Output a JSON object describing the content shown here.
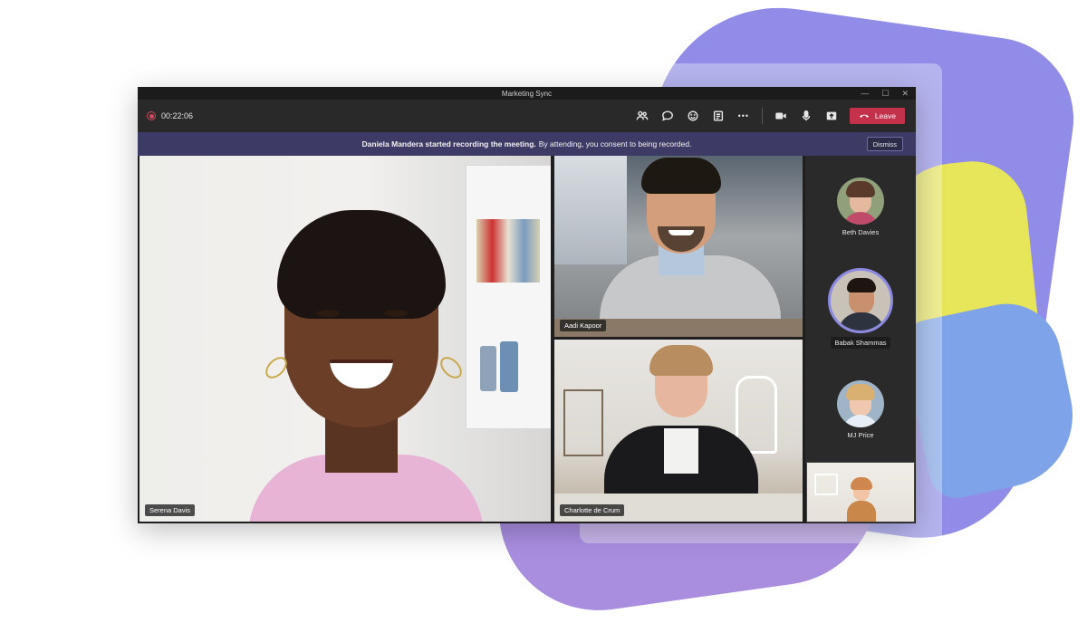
{
  "window": {
    "title": "Marketing Sync",
    "min_label": "—",
    "max_label": "☐",
    "close_label": "✕"
  },
  "toolbar": {
    "timer": "00:22:06",
    "icons": [
      "people-icon",
      "chat-icon",
      "reactions-icon",
      "notes-icon",
      "more-icon",
      "camera-icon",
      "mic-icon",
      "share-icon"
    ],
    "more_label": "•••",
    "leave_label": "Leave"
  },
  "banner": {
    "bold_text": "Daniela Mandera started recording the meeting.",
    "text": "By attending, you consent to being recorded.",
    "dismiss_label": "Dismiss"
  },
  "stage": {
    "main": {
      "name": "Serena Davis"
    },
    "tiles": [
      {
        "name": "Aadi Kapoor"
      },
      {
        "name": "Charlotte de Crum"
      }
    ]
  },
  "roster": [
    {
      "name": "Beth Davies",
      "speaking": false
    },
    {
      "name": "Babak Shammas",
      "speaking": true
    },
    {
      "name": "MJ Price",
      "speaking": false
    }
  ],
  "colors": {
    "accent": "#8b8ae0",
    "leave": "#c4314b",
    "banner": "#3d3b66",
    "recording": "#d74862"
  }
}
